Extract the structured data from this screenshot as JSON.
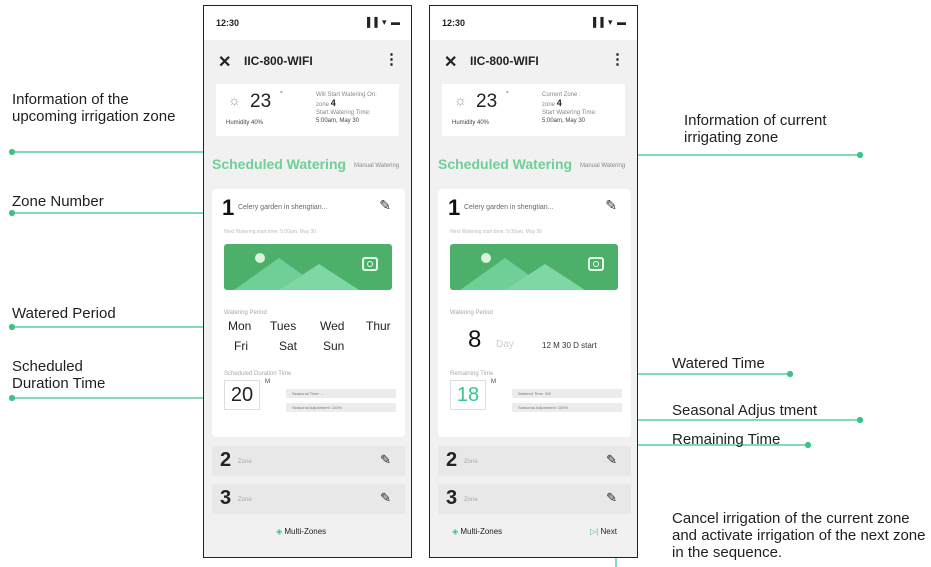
{
  "annotations": {
    "upcoming": "Information of the upcoming irrigation zone",
    "zone_number": "Zone Number",
    "watered_period": "Watered Period",
    "scheduled_duration": "Scheduled Duration Time",
    "current": "Information of current irrigating zone",
    "watered_time": "Watered Time",
    "seasonal": "Seasonal Adjus tment",
    "remaining": "Remaining Time",
    "cancel": "Cancel irrigation of the current zone and activate irrigation of the next zone in the sequence."
  },
  "phone": {
    "status_time": "12:30",
    "status_icons": "▐▐ ▾ ▬",
    "close": "✕",
    "title": "IIC-800-WIFI",
    "more": "⋮",
    "sun": "☼",
    "temperature": "23",
    "degree": "°",
    "humidity": "Humidity   40%",
    "scheduled_tab": "Scheduled Watering",
    "manual_tab": "Manual Watering",
    "edit_icon": "✎",
    "zone1_name": "Celery garden in shengtian...",
    "next_start": "Next Watering start time: 5:00am, May 30",
    "watering_period_label": "Watering Period",
    "zone2": "2",
    "zone3": "3",
    "zone_label": "Zone",
    "multi_zones": "Multi-Zones"
  },
  "left": {
    "will_start": "Will Start Watering On:",
    "zone_prefix": "zone",
    "zone_value": "4",
    "start_time_label": "Start Watering Time:",
    "start_time": "5:00am, May 30",
    "zone1": "1",
    "days": [
      "Mon",
      "Tues",
      "Wed",
      "Thur",
      "Fri",
      "Sat",
      "Sun"
    ],
    "duration_label": "Scheduled Duration Time",
    "duration": "20",
    "unit": "M",
    "bar1": "Seasonal Time: ...",
    "bar2": "Seasonal Adjustment: 100%"
  },
  "right": {
    "current_zone": "Current Zone :",
    "zone_prefix": "zone",
    "zone_value": "4",
    "start_time_label": "Start Watering Time:",
    "start_time": "5:00am, May 30",
    "zone1": "1",
    "period_value": "8",
    "period_unit": "Day",
    "period_extra": "12  M  30  D start",
    "remaining_label": "Remaining Time",
    "remaining": "18",
    "unit": "M",
    "bar1": "Watered Time: 2M",
    "bar2": "Seasonal Adjustment: 100%",
    "next_icon": "▷|",
    "next": "Next"
  }
}
